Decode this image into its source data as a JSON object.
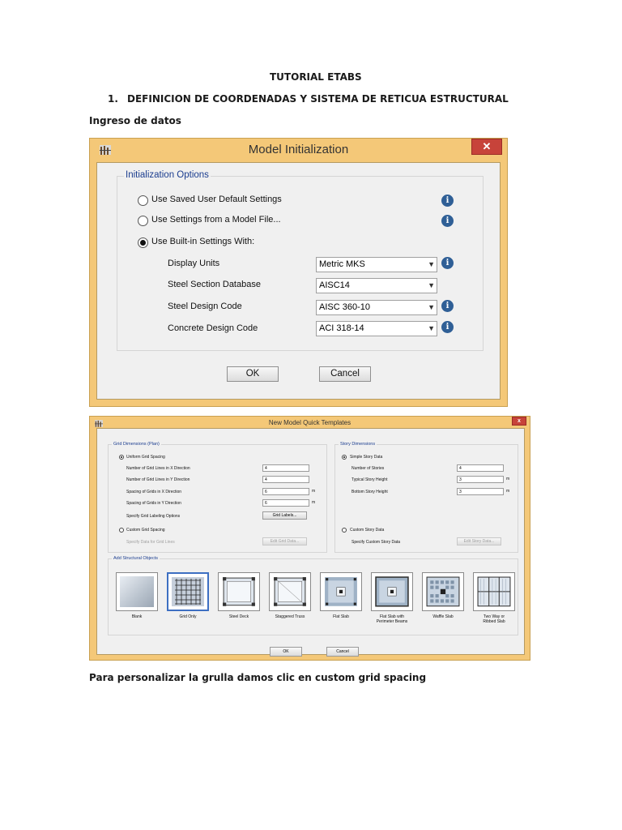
{
  "doc": {
    "title": "TUTORIAL ETABS",
    "section_number": "1.",
    "section_title": "DEFINICION DE COORDENADAS Y SISTEMA DE RETICUA ESTRUCTURAL",
    "intro": "Ingreso de datos",
    "footer": "Para personalizar la grulla damos clic en custom grid spacing"
  },
  "model_init": {
    "title": "Model Initialization",
    "close_icon": "close-icon",
    "group_label": "Initialization Options",
    "options": [
      {
        "label": "Use Saved User Default Settings",
        "selected": false
      },
      {
        "label": "Use Settings from a Model File...",
        "selected": false
      },
      {
        "label": "Use Built-in Settings With:",
        "selected": true
      }
    ],
    "fields": [
      {
        "label": "Display Units",
        "value": "Metric MKS",
        "info": true
      },
      {
        "label": "Steel Section Database",
        "value": "AISC14",
        "info": false
      },
      {
        "label": "Steel Design Code",
        "value": "AISC 360-10",
        "info": true
      },
      {
        "label": "Concrete Design Code",
        "value": "ACI 318-14",
        "info": true
      }
    ],
    "info_glyph": "i",
    "ok_label": "OK",
    "cancel_label": "Cancel"
  },
  "quick_templates": {
    "title": "New Model Quick Templates",
    "close_glyph": "x",
    "grid": {
      "group_label": "Grid Dimensions (Plan)",
      "uniform_label": "Uniform Grid Spacing",
      "rows": [
        {
          "label": "Number of Grid Lines in X Direction",
          "value": "4",
          "unit": ""
        },
        {
          "label": "Number of Grid Lines in Y Direction",
          "value": "4",
          "unit": ""
        },
        {
          "label": "Spacing of Grids in X Direction",
          "value": "6",
          "unit": "m"
        },
        {
          "label": "Spacing of Grids in Y Direction",
          "value": "6",
          "unit": "m"
        }
      ],
      "labeling_label": "Specify Grid Labeling Options",
      "grid_labels_button": "Grid Labels...",
      "custom_label": "Custom Grid Spacing",
      "custom_data_label": "Specify Data for Grid Lines",
      "edit_grid_button": "Edit Grid Data..."
    },
    "story": {
      "group_label": "Story Dimensions",
      "simple_label": "Simple Story Data",
      "rows": [
        {
          "label": "Number of Stories",
          "value": "4",
          "unit": ""
        },
        {
          "label": "Typical Story Height",
          "value": "3",
          "unit": "m"
        },
        {
          "label": "Bottom Story Height",
          "value": "3",
          "unit": "m"
        }
      ],
      "custom_label": "Custom Story Data",
      "custom_data_label": "Specify Custom Story Data",
      "edit_story_button": "Edit Story Data..."
    },
    "objects": {
      "group_label": "Add Structural Objects",
      "templates": [
        {
          "name": "Blank",
          "line2": ""
        },
        {
          "name": "Grid Only",
          "line2": ""
        },
        {
          "name": "Steel Deck",
          "line2": ""
        },
        {
          "name": "Staggered Truss",
          "line2": ""
        },
        {
          "name": "Flat Slab",
          "line2": ""
        },
        {
          "name": "Flat Slab with",
          "line2": "Perimeter Beams"
        },
        {
          "name": "Waffle Slab",
          "line2": ""
        },
        {
          "name": "Two Way or",
          "line2": "Ribbed Slab"
        }
      ],
      "selected_index": 1
    },
    "ok_label": "OK",
    "cancel_label": "Cancel"
  },
  "colors": {
    "window_frame": "#f4c878",
    "close_button": "#c7433a",
    "group_label_text": "#1b3d8f",
    "info_icon": "#2f5f96",
    "selected_template": "#3d6fc2"
  }
}
